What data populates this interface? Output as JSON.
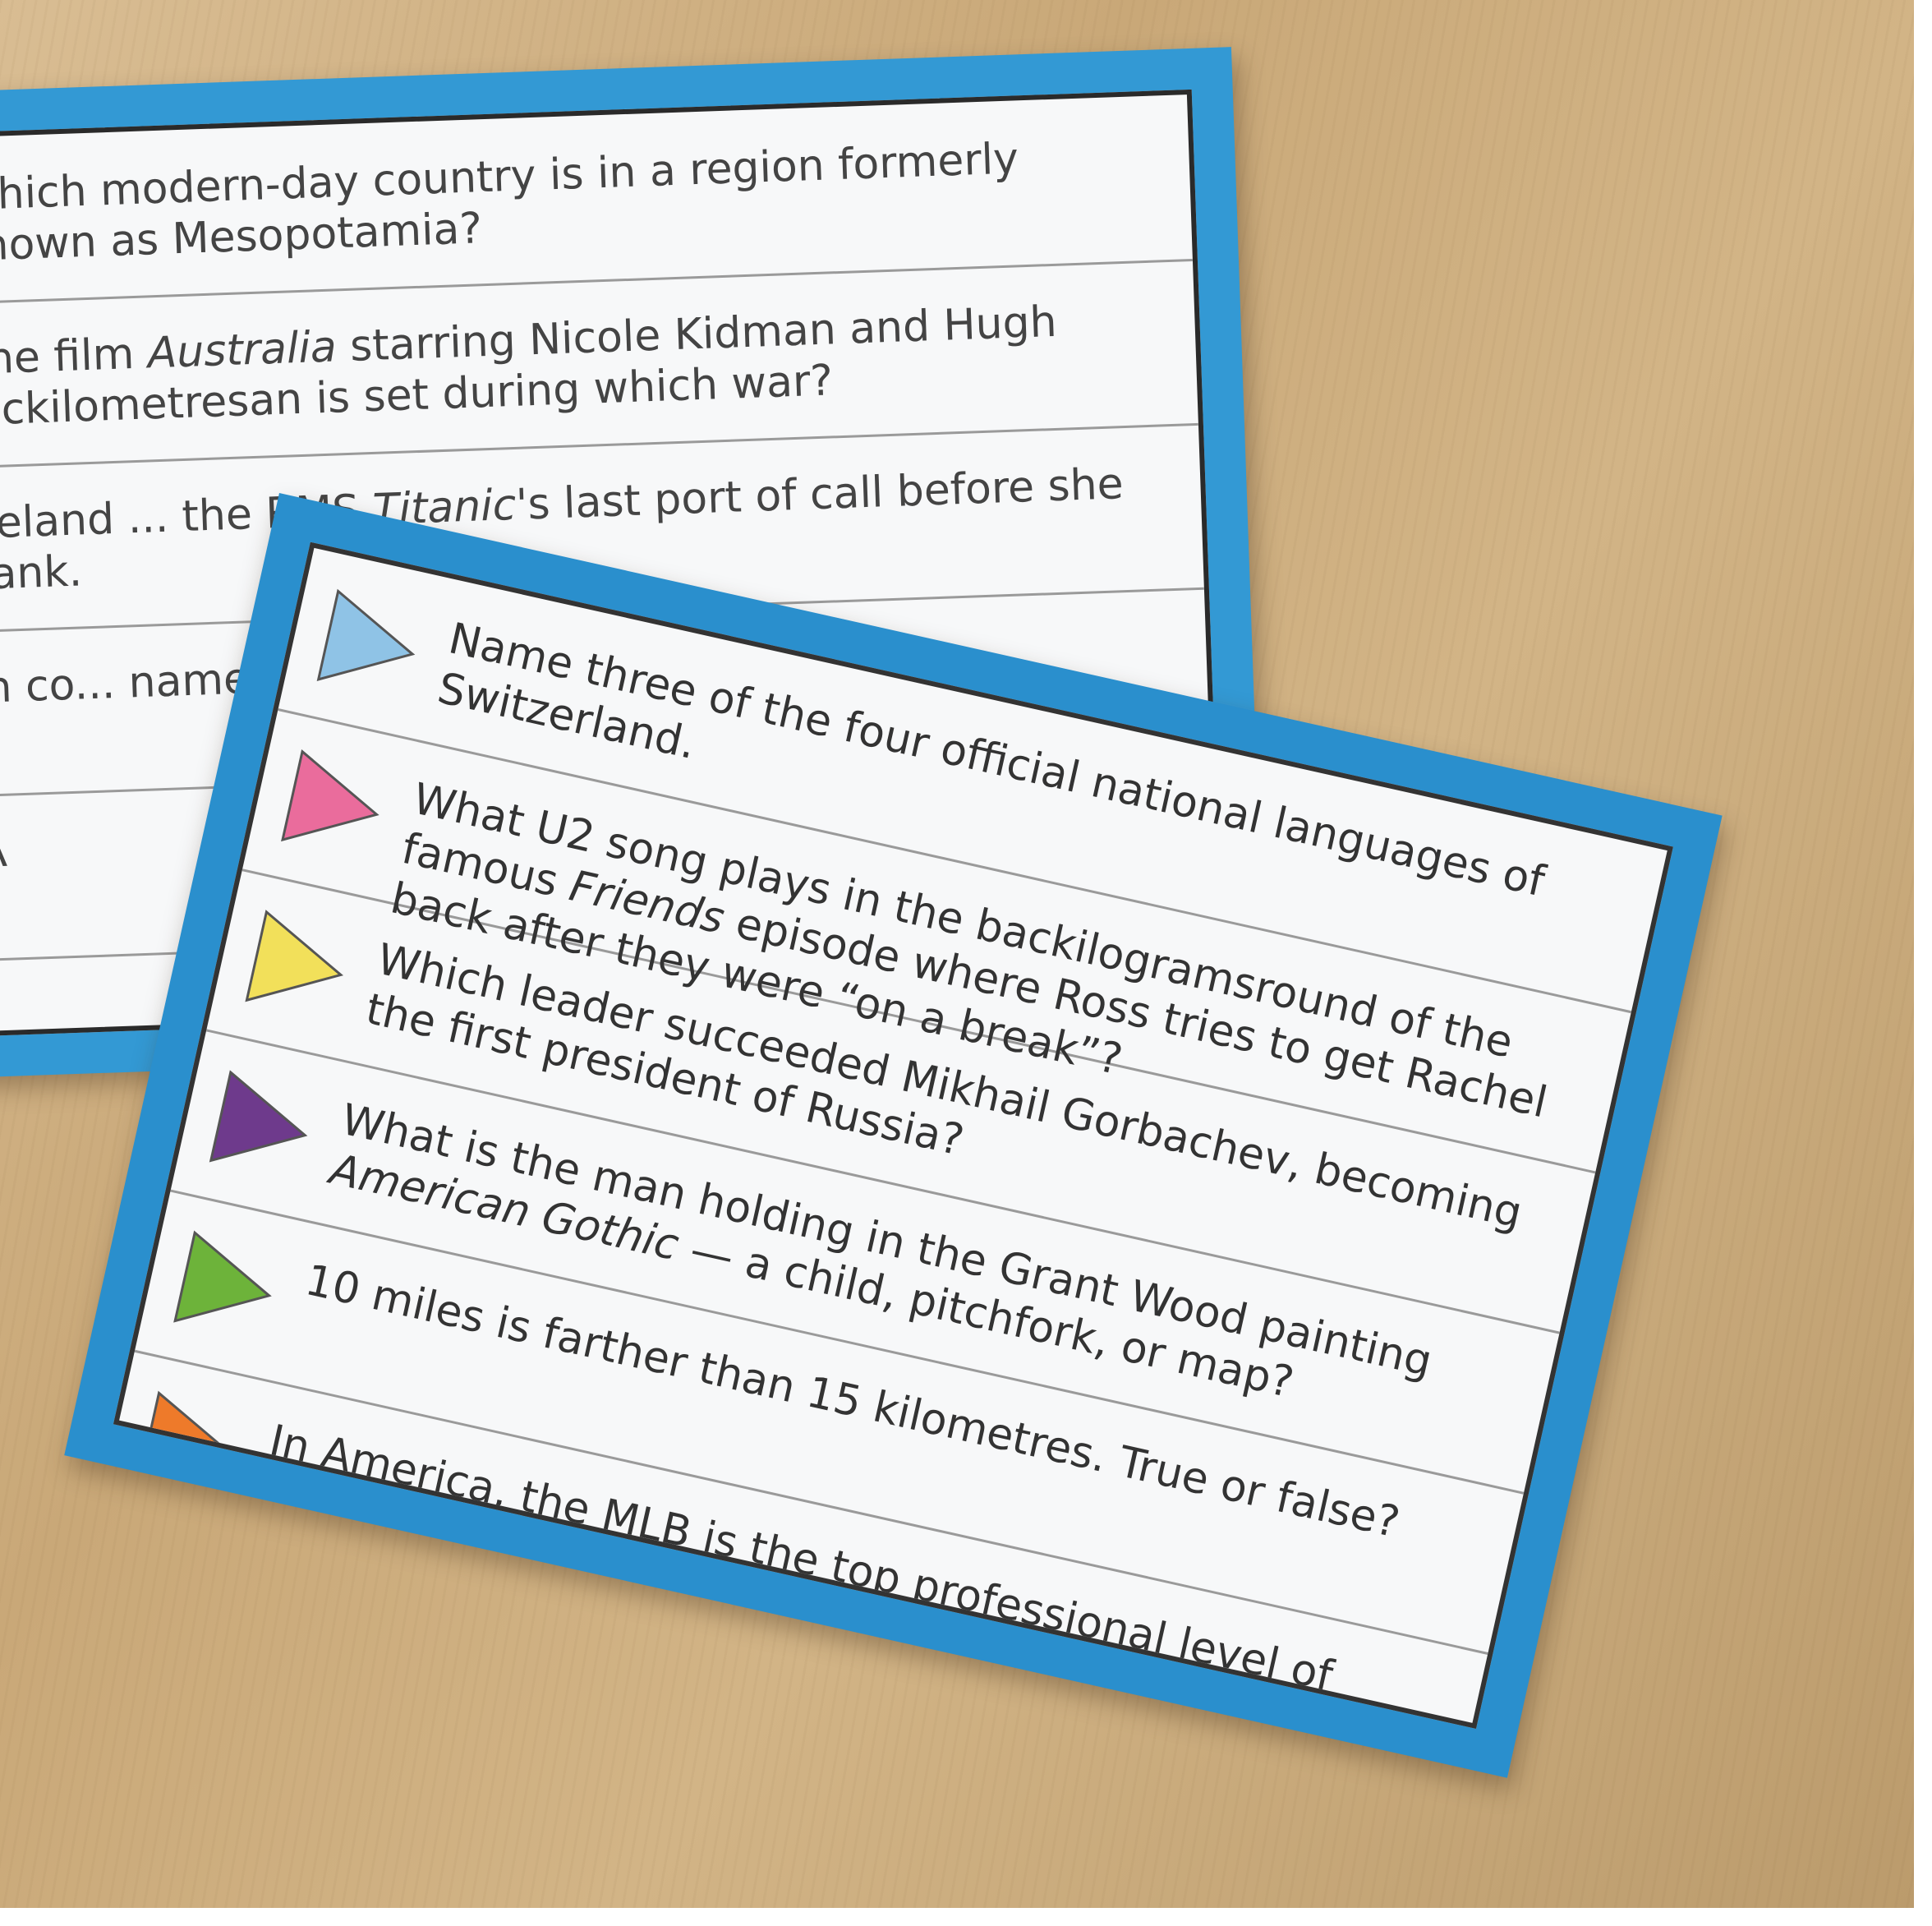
{
  "back_card": {
    "questions": [
      {
        "icon": "blue-triangle-icon",
        "color": "#8fc3e6",
        "text": "Which modern-day country is in a region formerly known as Mesopotamia?"
      },
      {
        "icon": "pink-triangle-icon",
        "color": "#ea6c9c",
        "pre": "The film ",
        "italic": "Australia",
        "post": " starring Nicole Kidman and Hugh Jackilometresan is set during which war?"
      },
      {
        "icon": "yellow-triangle-icon",
        "color": "#f2e05a",
        "pre": "Ireland ... the RMS ",
        "italic": "Titanic",
        "post": "'s last port of call before she sank."
      },
      {
        "icon": "purple-triangle-icon",
        "color": "#6e3a8c",
        "text": "In co... name for a tiny pict..."
      },
      {
        "icon": "green-triangle-icon",
        "color": "#6db33a",
        "text": "A"
      },
      {
        "icon": "orange-triangle-icon",
        "color": "#ee7a2a",
        "text": ""
      }
    ]
  },
  "front_card": {
    "questions": [
      {
        "icon": "blue-triangle-icon",
        "color": "#8fc3e6",
        "text": "Name three of the four official national languages of Switzerland."
      },
      {
        "icon": "pink-triangle-icon",
        "color": "#ea6c9c",
        "pre": "What U2 song plays in the backilogramsround of the famous ",
        "italic": "Friends",
        "post": " episode where Ross tries to get Rachel back after they were “on a break”?"
      },
      {
        "icon": "yellow-triangle-icon",
        "color": "#f2e05a",
        "text": "Which leader succeeded Mikhail Gorbachev, becoming the first president of Russia?"
      },
      {
        "icon": "purple-triangle-icon",
        "color": "#6e3a8c",
        "pre": "What is the man holding in the Grant Wood painting ",
        "italic": "American Gothic",
        "post": " — a child, pitchfork, or map?"
      },
      {
        "icon": "green-triangle-icon",
        "color": "#6db33a",
        "text": "10 miles is farther than 15 kilometres. True or false?"
      },
      {
        "icon": "orange-triangle-icon",
        "color": "#ee7a2a",
        "text": "In America, the MLB is the top professional level of sport?"
      }
    ]
  }
}
